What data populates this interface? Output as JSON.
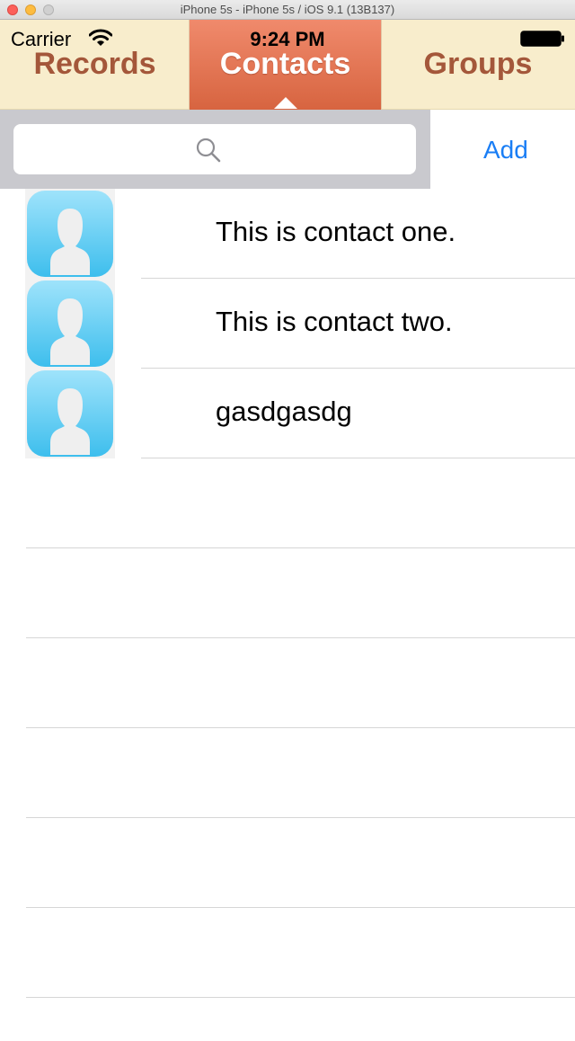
{
  "window": {
    "title": "iPhone 5s - iPhone 5s / iOS 9.1 (13B137)"
  },
  "status_bar": {
    "carrier": "Carrier",
    "time": "9:24 PM"
  },
  "tabs": [
    {
      "label": "Records",
      "selected": false
    },
    {
      "label": "Contacts",
      "selected": true
    },
    {
      "label": "Groups",
      "selected": false
    }
  ],
  "search": {
    "placeholder": "",
    "value": ""
  },
  "toolbar": {
    "add_label": "Add"
  },
  "contacts": [
    {
      "name": "This is contact one.",
      "avatar": "person-silhouette-icon"
    },
    {
      "name": "This is contact two.",
      "avatar": "person-silhouette-icon"
    },
    {
      "name": "gasdgasdg",
      "avatar": "person-silhouette-icon"
    }
  ],
  "colors": {
    "tab_background": "#f8edcc",
    "tab_text": "#a4573a",
    "tab_selected": "#e4714f",
    "search_background": "#c9c9ce",
    "accent": "#1a7ef5",
    "avatar_blue": "#5fcaf0"
  }
}
